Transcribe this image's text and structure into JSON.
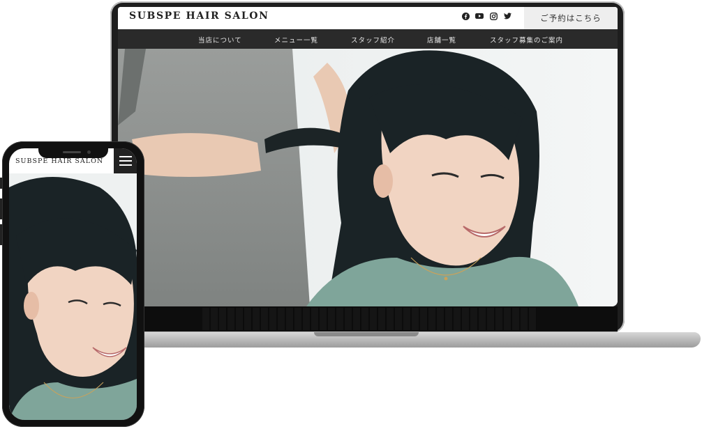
{
  "desktop": {
    "logo": "SUBSPE HAIR SALON",
    "social_icons": [
      "facebook-icon",
      "youtube-icon",
      "instagram-icon",
      "twitter-icon"
    ],
    "reserve_label": "ご予約はこちら",
    "nav": [
      "当店について",
      "メニュー一覧",
      "スタッフ紹介",
      "店舗一覧",
      "スタッフ募集のご案内"
    ]
  },
  "mobile": {
    "logo": "SUBSPE HAIR SALON",
    "menu_icon": "hamburger-icon"
  },
  "colors": {
    "nav_bg": "#2a2a2a",
    "reserve_bg": "#eeeeee",
    "device_frame": "#1e1e1e"
  }
}
